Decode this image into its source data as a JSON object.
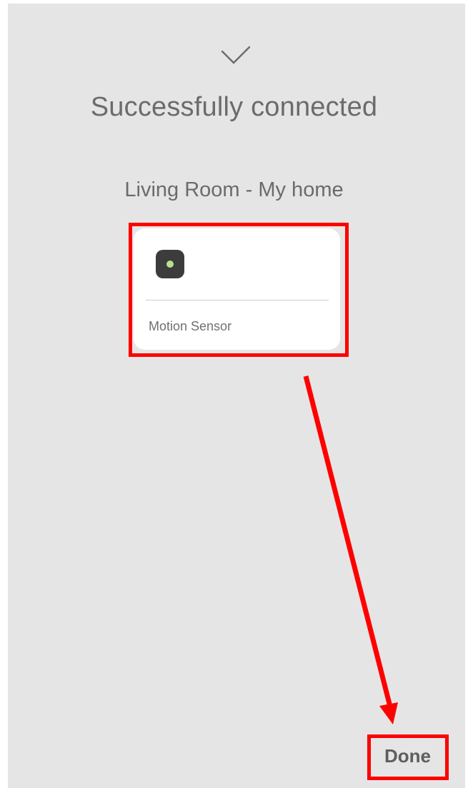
{
  "status": {
    "title": "Successfully connected",
    "icon": "check-icon"
  },
  "location": {
    "label": "Living Room - My home"
  },
  "device": {
    "name": "Motion Sensor",
    "icon": "motion-sensor-icon",
    "status_color": "#b8e08f"
  },
  "footer": {
    "done_label": "Done"
  },
  "annotations": {
    "highlight_color": "#ff0000"
  }
}
